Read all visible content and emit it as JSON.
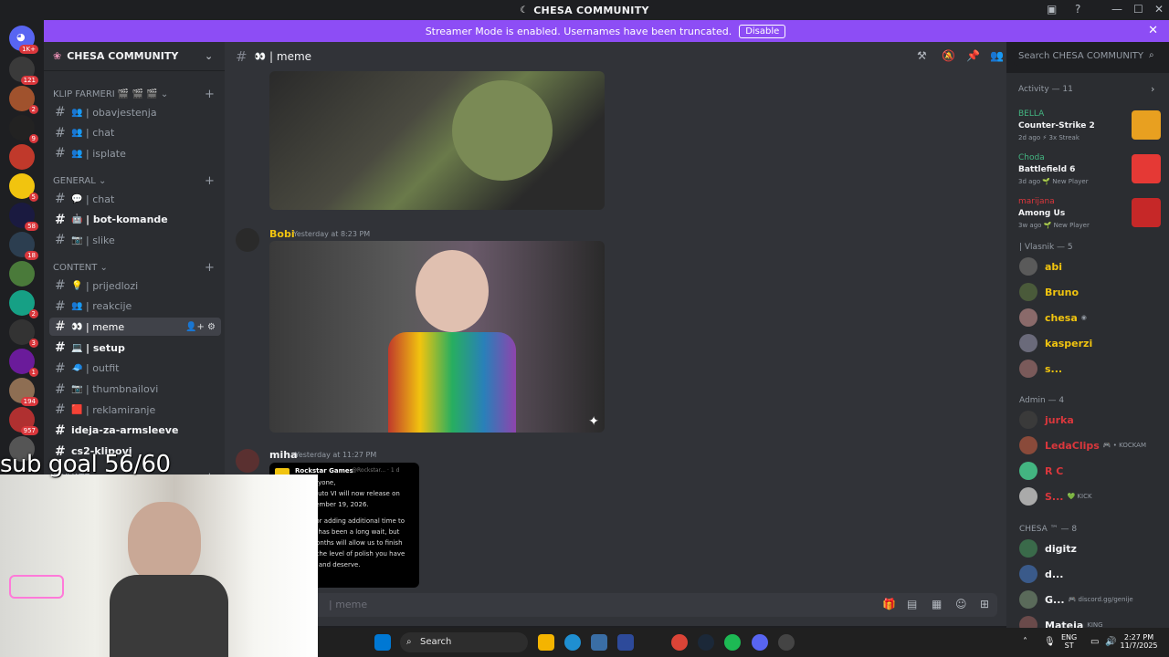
{
  "window": {
    "title": "CHESA COMMUNITY",
    "app_icon": "discord-icon"
  },
  "banner": {
    "text": "Streamer Mode is enabled. Usernames have been truncated.",
    "button": "Disable",
    "close": "✕",
    "color": "#8d4df5"
  },
  "rail": {
    "dm_badge": "1K+",
    "servers": [
      {
        "badge": "121",
        "color": "#3a3a3a"
      },
      {
        "badge": "2",
        "color": "#a0522d"
      },
      {
        "badge": "9",
        "color": "#222"
      },
      {
        "badge": "",
        "color": "#c0392b"
      },
      {
        "badge": "5",
        "color": "#f1c40f"
      },
      {
        "badge": "58",
        "color": "#1a1a40"
      },
      {
        "badge": "18",
        "color": "#2c3e50"
      },
      {
        "badge": "",
        "color": "#4a7a3a"
      },
      {
        "badge": "2",
        "color": "#16a085"
      },
      {
        "badge": "3",
        "color": "#333"
      },
      {
        "badge": "1",
        "color": "#6a1b9a"
      },
      {
        "badge": "194",
        "color": "#8e6e53"
      },
      {
        "badge": "957",
        "color": "#b03030"
      },
      {
        "badge": "",
        "color": "#555"
      }
    ]
  },
  "sidebar": {
    "server_name": "CHESA COMMUNITY",
    "categories": [
      {
        "label": "KLIP FARMERI 🎬 🎬 🎬",
        "channels": [
          {
            "emoji": "👥",
            "name": "| obavjestenja"
          },
          {
            "emoji": "👥",
            "name": "| chat"
          },
          {
            "emoji": "👥",
            "name": "| isplate"
          }
        ]
      },
      {
        "label": "GENERAL",
        "channels": [
          {
            "emoji": "💬",
            "name": "| chat"
          },
          {
            "emoji": "🤖",
            "name": "| bot-komande"
          },
          {
            "emoji": "📷",
            "name": "| slike"
          }
        ]
      },
      {
        "label": "CONTENT",
        "channels": [
          {
            "emoji": "💡",
            "name": "| prijedlozi"
          },
          {
            "emoji": "👥",
            "name": "| reakcije"
          },
          {
            "emoji": "👀",
            "name": "| meme"
          },
          {
            "emoji": "💻",
            "name": "| setup"
          },
          {
            "emoji": "🧢",
            "name": "| outfit"
          },
          {
            "emoji": "📷",
            "name": "| thumbnailovi"
          },
          {
            "emoji": "🟥",
            "name": "| reklamiranje"
          },
          {
            "emoji": "",
            "name": "ideja-za-armsleeve"
          },
          {
            "emoji": "",
            "name": "cs2-klipovi"
          }
        ]
      },
      {
        "label": "PRIVATE",
        "channels": []
      }
    ]
  },
  "chat": {
    "channel_name": "| meme",
    "search_placeholder": "Search CHESA COMMUNITY",
    "composer_placeholder": "| meme",
    "messages": [
      {
        "author": "Bobi",
        "time": "Yesterday at 8:23 PM"
      },
      {
        "author": "miha",
        "time": "Yesterday at 11:27 PM"
      }
    ],
    "tweet": {
      "account": "Rockstar Games",
      "handle": "@Rockstar... · 1 d",
      "lines": [
        "Hi everyone,",
        "Theft Auto VI will now release on",
        "y, November 19, 2026.",
        "sorry for adding additional time to",
        "realize has been a long wait, but",
        "xtra months will allow us to finish",
        "e with the level of polish you have",
        "expect and deserve."
      ]
    }
  },
  "members": {
    "activity_title": "Activity — 11",
    "activities": [
      {
        "user": "BELLA",
        "user_color": "#43b581",
        "game": "Counter-Strike 2",
        "meta": "2d ago  ⚡ 3x Streak",
        "icon_color": "#e8a020"
      },
      {
        "user": "Choda",
        "user_color": "#43b581",
        "game": "Battlefield 6",
        "meta": "3d ago  🌱 New Player",
        "icon_color": "#e53935"
      },
      {
        "user": "marijana",
        "user_color": "#da373c",
        "game": "Among Us",
        "meta": "3w ago  🌱 New Player",
        "icon_color": "#c62828"
      }
    ],
    "groups": [
      {
        "label": "| Vlasnik — 5",
        "members": [
          {
            "name": "abi",
            "color": "#f1c40f",
            "sub": "",
            "av": "#5a5a5a"
          },
          {
            "name": "Bruno",
            "color": "#f1c40f",
            "sub": "",
            "av": "#4a5a3a"
          },
          {
            "name": "chesa",
            "color": "#f1c40f",
            "sub": "◉",
            "av": "#8a6a6a"
          },
          {
            "name": "kasperzi",
            "color": "#f1c40f",
            "sub": "",
            "av": "#6a6a7a"
          },
          {
            "name": "s...",
            "color": "#f1c40f",
            "sub": "",
            "av": "#7a5a5a"
          }
        ]
      },
      {
        "label": "Admin — 4",
        "members": [
          {
            "name": "jurka",
            "color": "#da373c",
            "sub": "",
            "av": "#3a3a3a"
          },
          {
            "name": "LedaClips",
            "color": "#da373c",
            "sub": "🎮 • KOCKAM",
            "av": "#8a4a3a"
          },
          {
            "name": "R C",
            "color": "#da373c",
            "sub": "",
            "av": "#43b581"
          },
          {
            "name": "S...",
            "color": "#da373c",
            "sub": "💚 KICK",
            "av": "#aaaaaa"
          }
        ]
      },
      {
        "label": "CHESA ™ — 8",
        "members": [
          {
            "name": "digitz",
            "color": "#f2f3f5",
            "sub": "",
            "av": "#3a6a4a"
          },
          {
            "name": "d...",
            "color": "#f2f3f5",
            "sub": "",
            "av": "#3a5a8a"
          },
          {
            "name": "G...",
            "color": "#f2f3f5",
            "sub": "🎮 discord.gg/genije",
            "av": "#5a6a5a"
          },
          {
            "name": "Mateja",
            "color": "#f2f3f5",
            "sub": "KING",
            "av": "#6a4a4a"
          }
        ]
      }
    ]
  },
  "overlay": {
    "subgoal": "sub goal 56/60"
  },
  "taskbar": {
    "search_label": "Search",
    "lang": "ENG",
    "region": "ST",
    "time": "2:27 PM",
    "date": "11/7/2025"
  }
}
